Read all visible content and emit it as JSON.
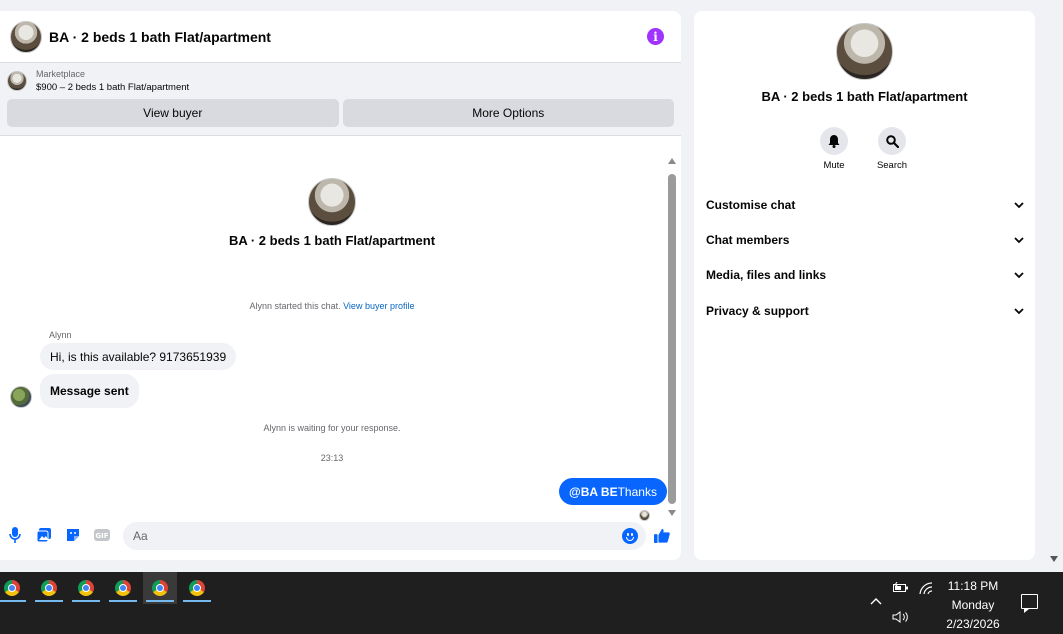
{
  "chat": {
    "title": "BA · 2 beds 1 bath Flat/apartment",
    "marketplace_label": "Marketplace",
    "listing_line": "$900 – 2 beds 1 bath Flat/apartment",
    "view_buyer_label": "View buyer",
    "more_options_label": "More Options",
    "center_title": "BA · 2 beds 1 bath Flat/apartment",
    "started_text": "Alynn started this chat.",
    "view_buyer_profile_label": "View buyer profile",
    "sender_name": "Alynn",
    "messages_in": [
      "Hi, is this available? 9173651939",
      "Message sent"
    ],
    "waiting_text": "Alynn is waiting for your response.",
    "timestamp": "23:13",
    "message_out_mention": "@BA BE",
    "message_out_text": "Thanks",
    "composer_placeholder": "Aa"
  },
  "details": {
    "title": "BA · 2 beds 1 bath Flat/apartment",
    "mute_label": "Mute",
    "search_label": "Search",
    "sections": [
      "Customise chat",
      "Chat members",
      "Media, files and links",
      "Privacy & support"
    ]
  },
  "taskbar": {
    "time": "11:18 PM",
    "day": "Monday",
    "date": "2/23/2026"
  },
  "colors": {
    "accent_blue": "#0866ff",
    "info_purple": "#a033ff",
    "bubble_gray": "#f0f2f5",
    "taskbar": "#1f1f1f"
  }
}
